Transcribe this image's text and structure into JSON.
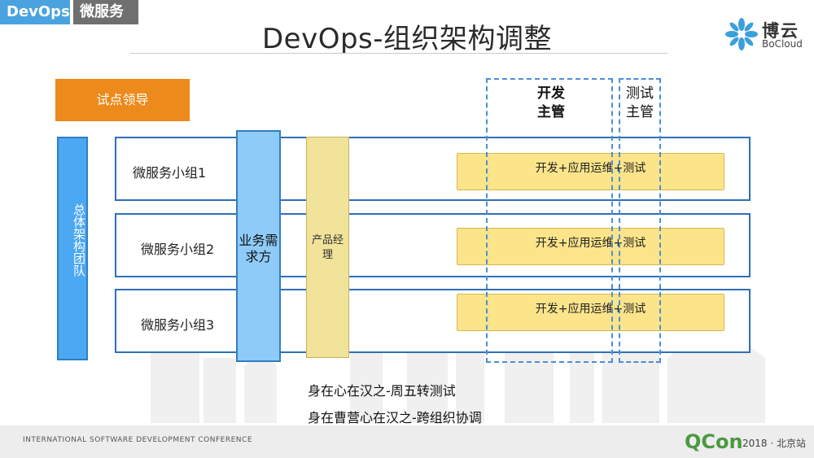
{
  "tags": {
    "devops": "DevOps",
    "microservice": "微服务"
  },
  "title": "DevOps-组织架构调整",
  "logo": {
    "name": "博云",
    "sub": "BoCloud",
    "icon": "bocloud-flower-icon",
    "color": "#3aa0dc"
  },
  "pilot": "试点领导",
  "team": "总体架构团队",
  "groups": [
    {
      "label": "微服务小组1",
      "devops": "开发+应用运维+测试"
    },
    {
      "label": "微服务小组2",
      "devops": "开发+应用运维+测试"
    },
    {
      "label": "微服务小组3",
      "devops": "开发+应用运维+测试"
    }
  ],
  "biz": "业务需求方",
  "pm": "产品经理",
  "dev_lead": "开发主管",
  "test_lead": "测试主管",
  "captions": [
    "身在心在汉之-周五转测试",
    "身在曹营心在汉之-跨组织协调"
  ],
  "footer": {
    "conference": "INTERNATIONAL SOFTWARE DEVELOPMENT CONFERENCE",
    "brand": "QCon",
    "year": "2018 · 北京站"
  },
  "colors": {
    "accent": "#4aa3df",
    "orange": "#ec8a1b",
    "row_border": "#2f6fb8",
    "yellow": "#fbe48a"
  }
}
